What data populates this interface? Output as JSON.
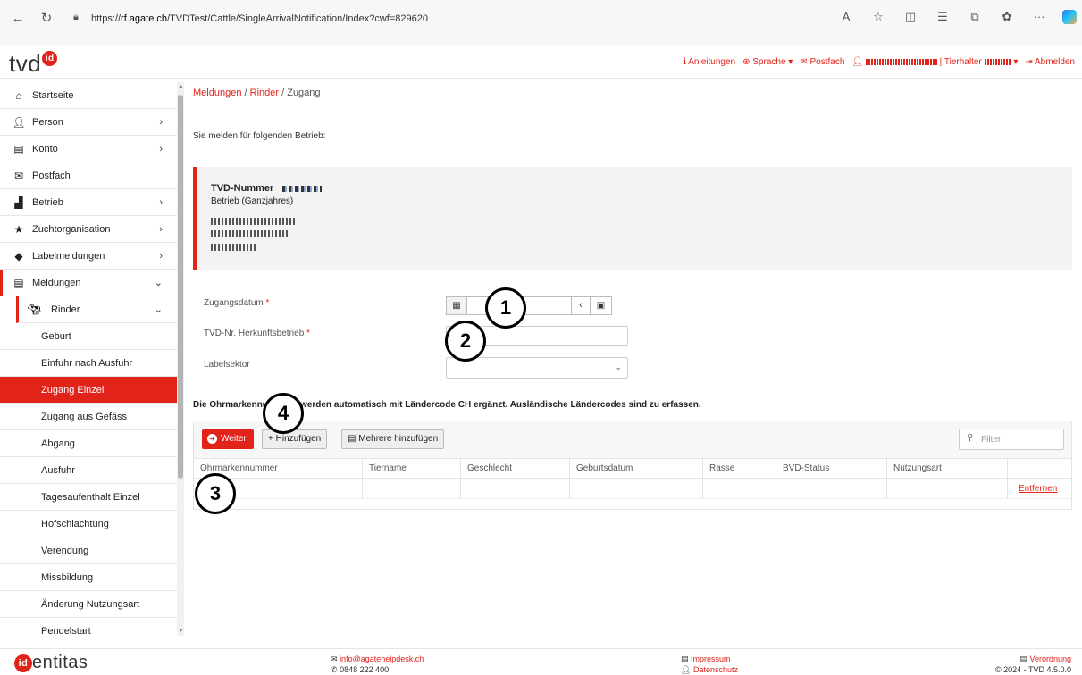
{
  "browser": {
    "url_prefix": "https://",
    "url_host": "rf.agate.ch",
    "url_path": "/TVDTest/Cattle/SingleArrivalNotification/Index?cwf=829620"
  },
  "header": {
    "logo_text": "tvd",
    "logo_badge": "id",
    "links": {
      "anleitungen": "Anleitungen",
      "sprache": "Sprache",
      "postfach": "Postfach",
      "tierhalter": "Tierhalter",
      "abmelden": "Abmelden"
    }
  },
  "sidebar": {
    "items": [
      {
        "label": "Startseite",
        "icon": "home-icon"
      },
      {
        "label": "Person",
        "icon": "user-icon",
        "chevron": "›"
      },
      {
        "label": "Konto",
        "icon": "money-icon",
        "chevron": "›"
      },
      {
        "label": "Postfach",
        "icon": "envelope-icon"
      },
      {
        "label": "Betrieb",
        "icon": "industry-icon",
        "chevron": "›"
      },
      {
        "label": "Zuchtorganisation",
        "icon": "star-icon",
        "chevron": "›"
      },
      {
        "label": "Labelmeldungen",
        "icon": "tags-icon",
        "chevron": "›"
      },
      {
        "label": "Meldungen",
        "icon": "clipboard-icon",
        "chevron": "⌄"
      }
    ],
    "rinder": {
      "label": "Rinder",
      "icon": "cow-icon",
      "chevron": "⌄"
    },
    "subitems": [
      "Geburt",
      "Einfuhr nach Ausfuhr",
      "Zugang Einzel",
      "Zugang aus Gefäss",
      "Abgang",
      "Ausfuhr",
      "Tagesaufenthalt Einzel",
      "Hofschlachtung",
      "Verendung",
      "Missbildung",
      "Änderung Nutzungsart",
      "Pendelstart"
    ],
    "selected": "Zugang Einzel"
  },
  "breadcrumb": {
    "part1": "Meldungen",
    "sep": "/",
    "part2": "Rinder",
    "part3": "Zugang"
  },
  "intro": "Sie melden für folgenden Betrieb:",
  "betrieb": {
    "tvd_label": "TVD-Nummer",
    "type": "Betrieb (Ganzjahres)"
  },
  "form": {
    "zugangsdatum_label": "Zugangsdatum",
    "herkunft_label": "TVD-Nr. Herkunftsbetrieb",
    "labelsektor_label": "Labelsektor",
    "required_mark": "*"
  },
  "note": "Die Ohrmarkennummern werden automatisch mit Ländercode CH ergänzt. Ausländische Ländercodes sind zu erfassen.",
  "toolbar": {
    "weiter": "Weiter",
    "hinzufuegen": "Hinzufügen",
    "mehrere": "Mehrere hinzufügen",
    "filter_placeholder": "Filter"
  },
  "table": {
    "columns": [
      "Ohrmarkennummer",
      "Tiername",
      "Geschlecht",
      "Geburtsdatum",
      "Rasse",
      "BVD-Status",
      "Nutzungsart",
      ""
    ],
    "row_action": "Entfernen"
  },
  "callouts": [
    "1",
    "2",
    "3",
    "4"
  ],
  "footer": {
    "brand": "entitas",
    "brand_badge": "id",
    "email": "info@agatehelpdesk.ch",
    "phone": "0848 222 400",
    "impressum": "Impressum",
    "datenschutz": "Datenschutz",
    "verordnung": "Verordnung",
    "version": "© 2024 - TVD 4.5.0.0"
  },
  "colors": {
    "accent": "#e2231a"
  }
}
